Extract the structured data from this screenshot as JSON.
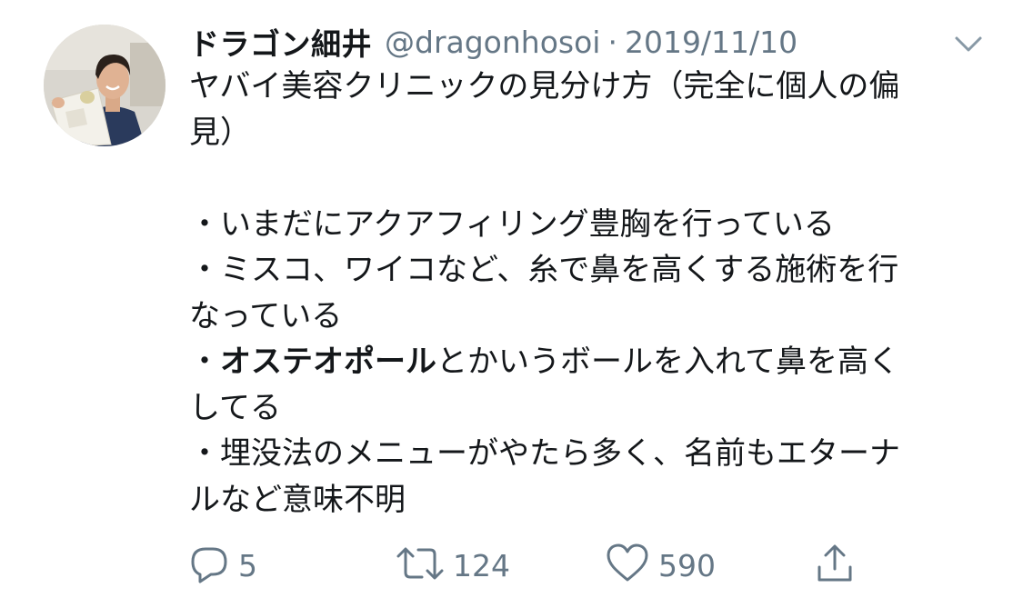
{
  "tweet": {
    "display_name": "ドラゴン細井",
    "handle": "@dragonhosoi",
    "separator": "·",
    "date": "2019/11/10",
    "lines": {
      "l1": "ヤバイ美容クリニックの見分け方（完全に個人の偏",
      "l2": "見）",
      "l3": "・いまだにアクアフィリング豊胸を行っている",
      "l4": "・ミスコ、ワイコなど、糸で鼻を高くする施術を行",
      "l5": "なっている",
      "l6_prefix": "・",
      "l6_bold": "オステオポール",
      "l6_rest": "とかいうボールを入れて鼻を高く",
      "l7": "してる",
      "l8": "・埋没法のメニューがやたら多く、名前もエターナ",
      "l9": "ルなど意味不明"
    }
  },
  "actions": {
    "reply_count": "5",
    "retweet_count": "124",
    "like_count": "590"
  },
  "icons": {
    "menu": "chevron-down-icon",
    "reply": "reply-icon",
    "retweet": "retweet-icon",
    "like": "heart-icon",
    "share": "share-icon"
  },
  "colors": {
    "text": "#14171a",
    "muted": "#657786",
    "icon": "#657786"
  }
}
